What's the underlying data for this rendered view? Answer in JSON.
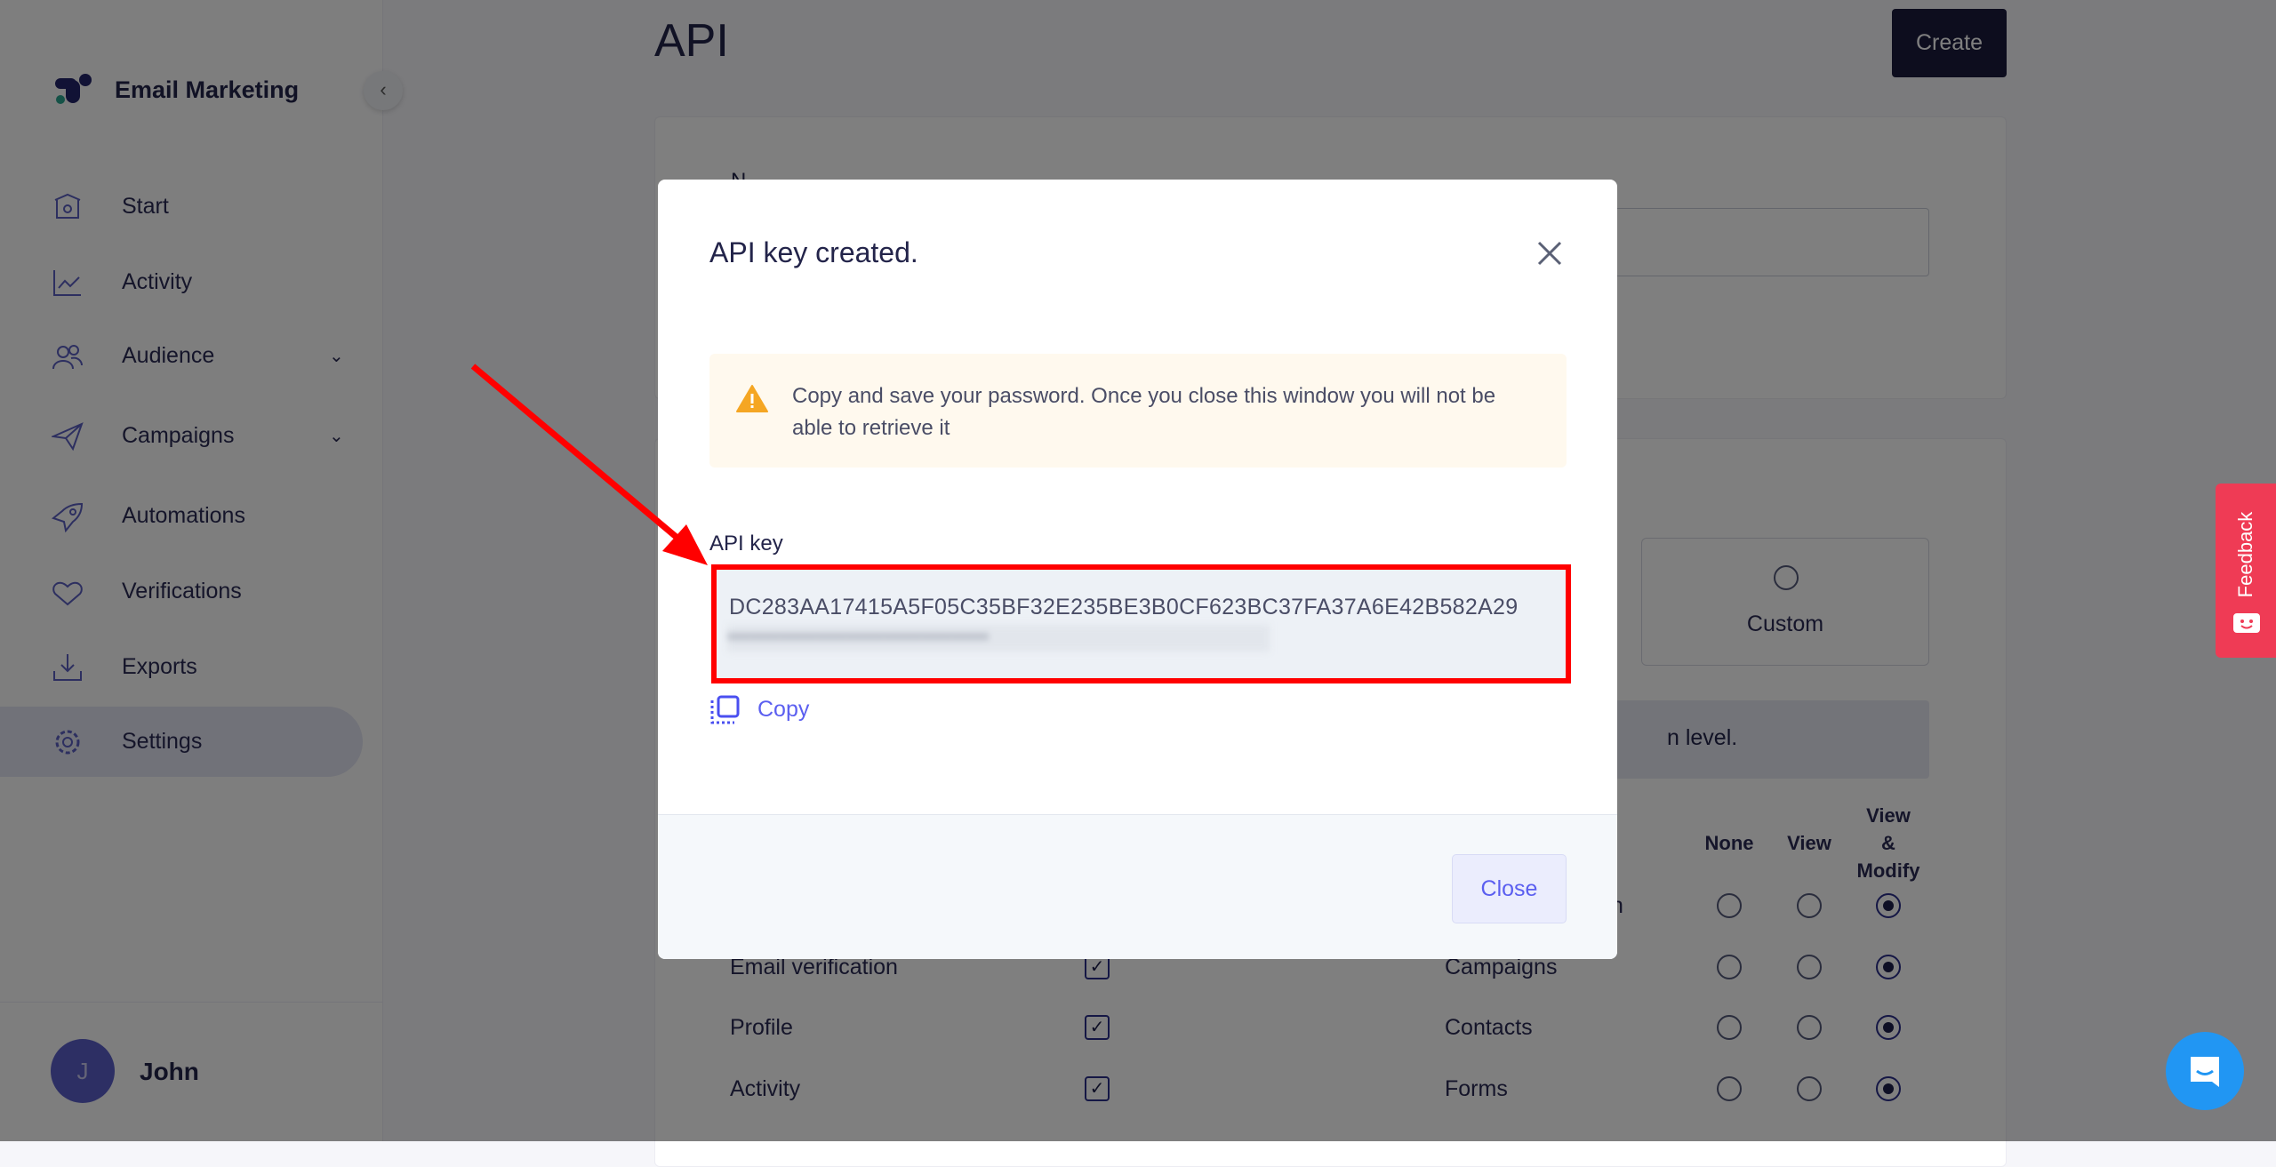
{
  "app": {
    "name": "Email Marketing"
  },
  "sidebar": {
    "items": [
      {
        "label": "Start",
        "icon": "home-icon"
      },
      {
        "label": "Activity",
        "icon": "chart-icon"
      },
      {
        "label": "Audience",
        "icon": "users-icon",
        "expandable": true
      },
      {
        "label": "Campaigns",
        "icon": "paper-plane-icon",
        "expandable": true
      },
      {
        "label": "Automations",
        "icon": "rocket-icon"
      },
      {
        "label": "Verifications",
        "icon": "heart-check-icon"
      },
      {
        "label": "Exports",
        "icon": "download-icon"
      },
      {
        "label": "Settings",
        "icon": "gear-icon",
        "active": true
      }
    ],
    "user": {
      "initial": "J",
      "name": "John"
    }
  },
  "page": {
    "title": "API",
    "create_label": "Create",
    "name_label": "N",
    "custom_label": "Custom",
    "info_fragment": "n level.",
    "row_fragment": "n",
    "perm_headers": [
      "None",
      "View",
      "View\n&\nModify"
    ],
    "rows": [
      {
        "left": "Email verification",
        "right": "Campaigns"
      },
      {
        "left": "Profile",
        "right": "Contacts"
      },
      {
        "left": "Activity",
        "right": "Forms"
      }
    ]
  },
  "modal": {
    "title": "API key created.",
    "warning": "Copy and save your password. Once you close this window you will not be able to retrieve it",
    "key_label": "API key",
    "key_value": "DC283AA17415A5F05C35BF32E235BE3B0CF623BC37FA37A6E42B582A29",
    "key_hidden": "•••••••••••••••••••••••••••••••••••",
    "copy_label": "Copy",
    "close_label": "Close"
  },
  "feedback": {
    "label": "Feedback"
  },
  "colors": {
    "accent": "#5b5ff0",
    "annotation": "#ff0000",
    "feedback": "#ef3b55",
    "chat": "#2196f3",
    "warning": "#f5a623"
  }
}
